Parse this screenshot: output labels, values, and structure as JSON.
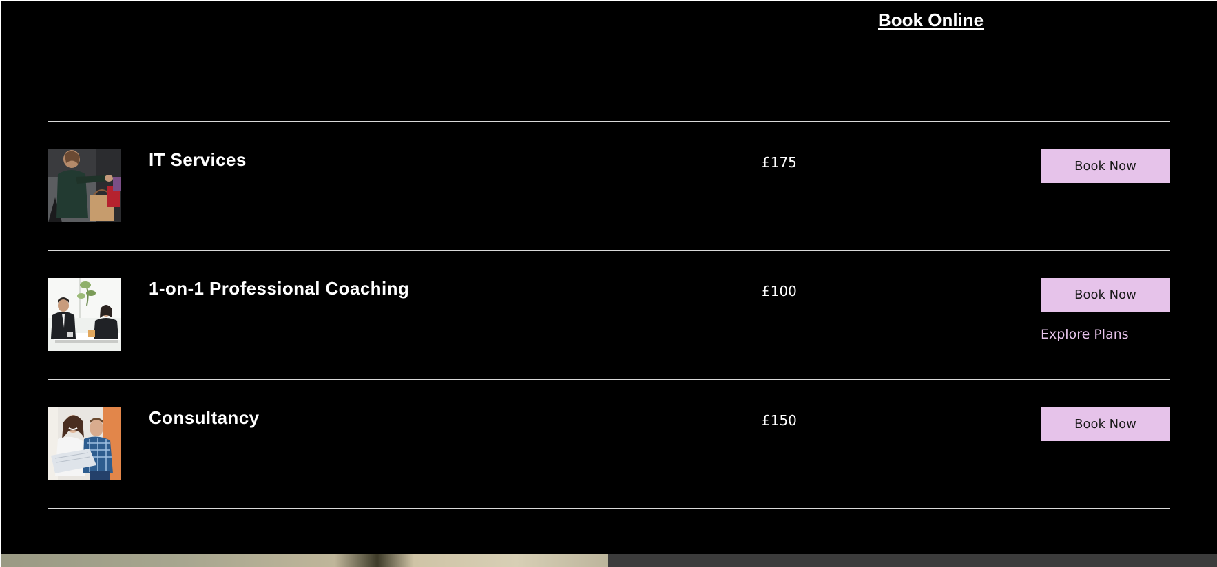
{
  "page": {
    "title": "Book Online"
  },
  "services": [
    {
      "name": "IT Services",
      "price": "£175",
      "button_label": "Book Now",
      "image": "woman-shopping-bags-photo"
    },
    {
      "name": "1-on-1 Professional Coaching",
      "price": "£100",
      "button_label": "Book Now",
      "link_label": "Explore Plans",
      "image": "business-meeting-photo"
    },
    {
      "name": "Consultancy",
      "price": "£150",
      "button_label": "Book Now",
      "image": "couple-reviewing-papers-photo"
    }
  ],
  "colors": {
    "background": "#000000",
    "text": "#ffffff",
    "accent": "#e6c3ea",
    "divider": "#d9d9d9"
  }
}
